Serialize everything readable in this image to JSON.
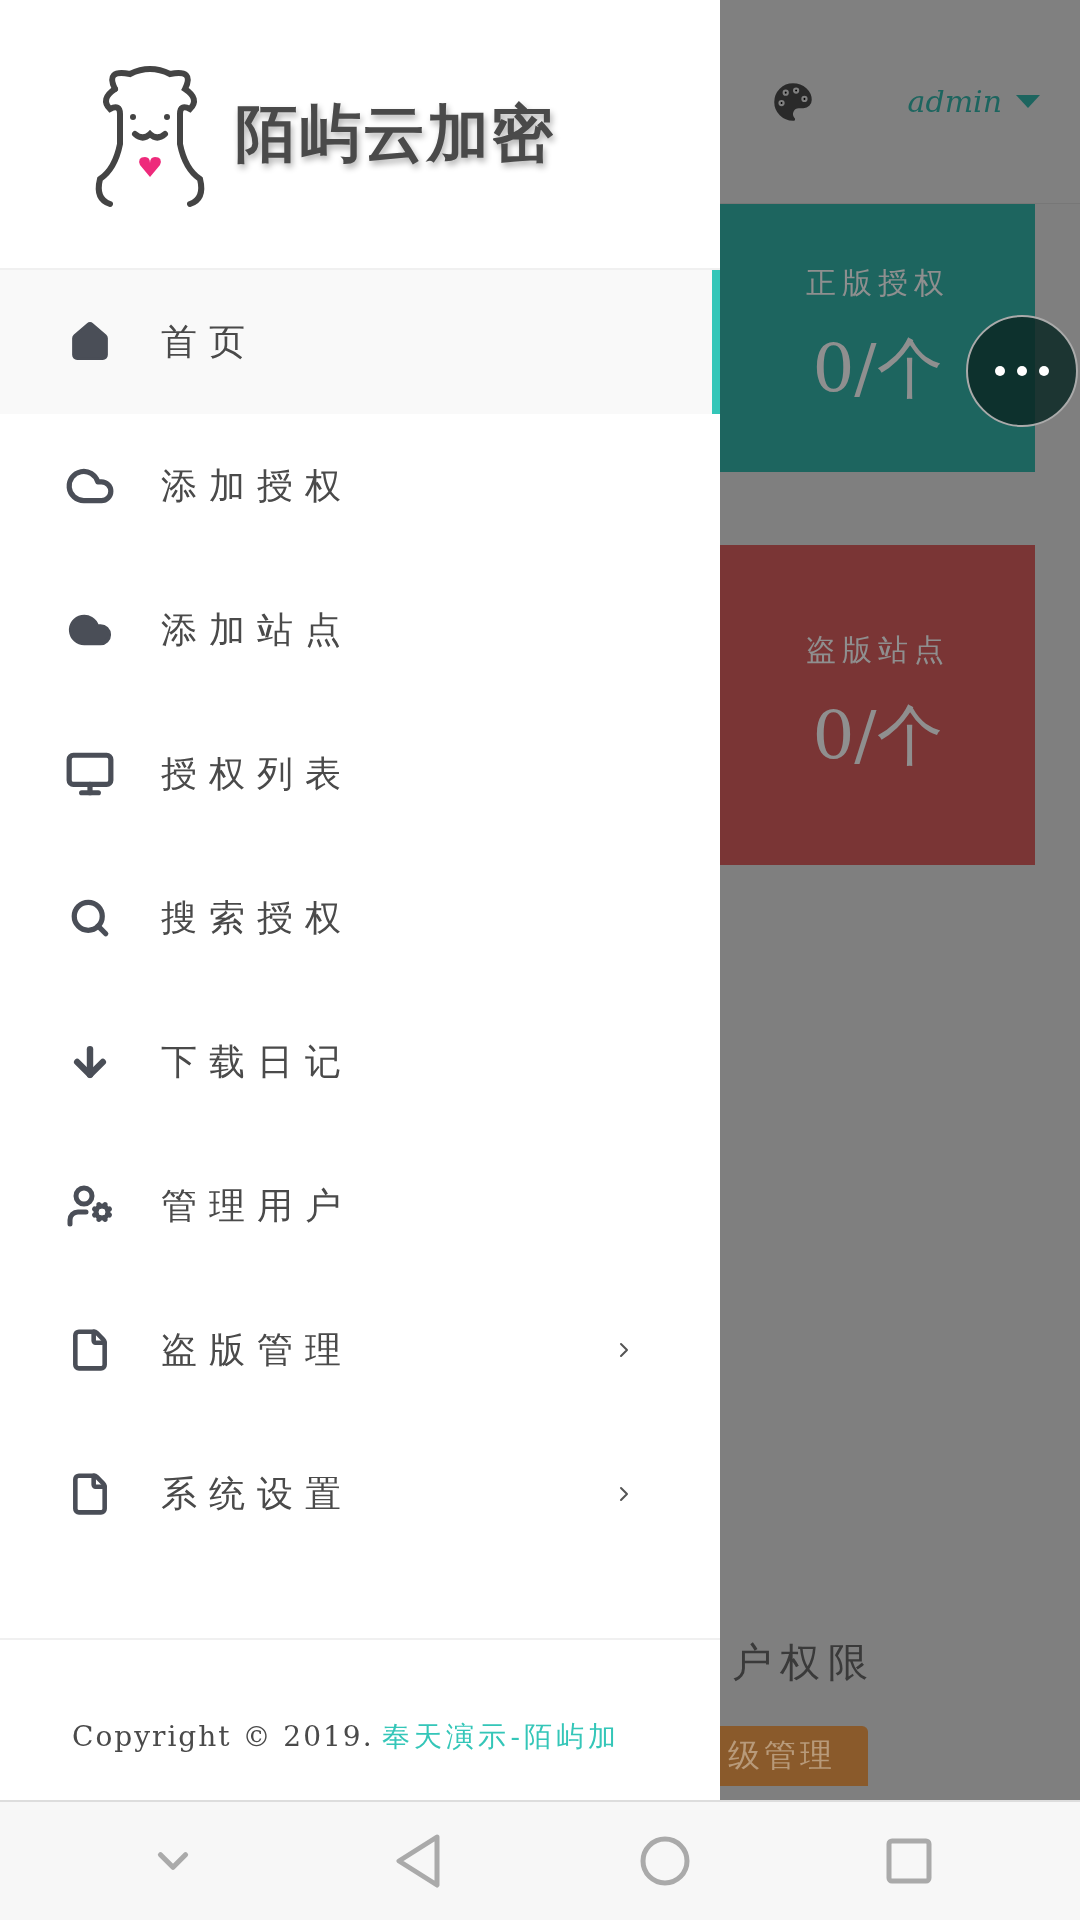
{
  "logo": {
    "text": "陌屿云加密"
  },
  "menu": [
    {
      "label": "首页",
      "kind": "home",
      "selected": true,
      "has_submenu": false
    },
    {
      "label": "添加授权",
      "kind": "cloud-outline",
      "selected": false,
      "has_submenu": false
    },
    {
      "label": "添加站点",
      "kind": "cloud",
      "selected": false,
      "has_submenu": false
    },
    {
      "label": "授权列表",
      "kind": "monitor",
      "selected": false,
      "has_submenu": false
    },
    {
      "label": "搜索授权",
      "kind": "search",
      "selected": false,
      "has_submenu": false
    },
    {
      "label": "下载日记",
      "kind": "arrow-down",
      "selected": false,
      "has_submenu": false
    },
    {
      "label": "管理用户",
      "kind": "user-gear",
      "selected": false,
      "has_submenu": false
    },
    {
      "label": "盗版管理",
      "kind": "file",
      "selected": false,
      "has_submenu": true
    },
    {
      "label": "系统设置",
      "kind": "file",
      "selected": false,
      "has_submenu": true
    }
  ],
  "footer": {
    "copyright": "Copyright © 2019.",
    "link": "奉天演示-陌屿加"
  },
  "background_page": {
    "user": "admin",
    "cards": [
      {
        "title": "正版授权",
        "value": "0/个",
        "color": "#1d655f"
      },
      {
        "title": "盗版站点",
        "value": "0/个",
        "color": "#7a3535"
      }
    ],
    "section_title": "户权限",
    "badge": "级管理"
  }
}
